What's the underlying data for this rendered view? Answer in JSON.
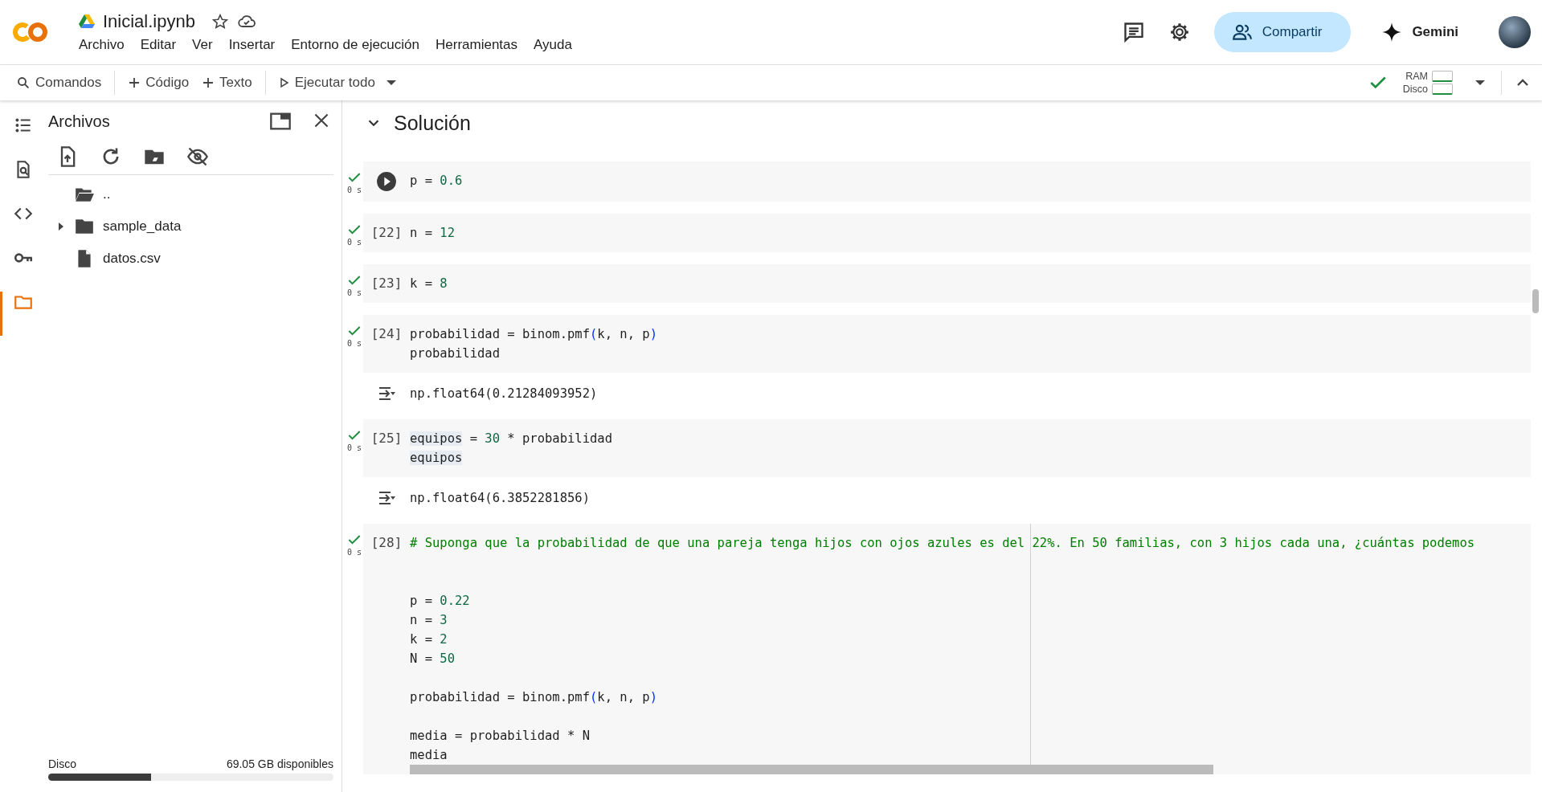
{
  "header": {
    "file_title": "Inicial.ipynb",
    "starred": false,
    "menu": [
      "Archivo",
      "Editar",
      "Ver",
      "Insertar",
      "Entorno de ejecución",
      "Herramientas",
      "Ayuda"
    ],
    "share_button": "Compartir",
    "gemini_button": "Gemini"
  },
  "toolbar": {
    "commands": "Comandos",
    "add_code": "Código",
    "add_text": "Texto",
    "run_all": "Ejecutar todo",
    "ram_label": "RAM",
    "disk_label": "Disco",
    "connected": true
  },
  "rail": [
    {
      "kind": "toc",
      "selected": false
    },
    {
      "kind": "find",
      "selected": false
    },
    {
      "kind": "code",
      "selected": false
    },
    {
      "kind": "key",
      "selected": false
    },
    {
      "kind": "files",
      "selected": true
    }
  ],
  "sidebar": {
    "title": "Archivos",
    "files": [
      {
        "name": "..",
        "kind": "parent"
      },
      {
        "name": "sample_data",
        "kind": "folder",
        "expanded": false
      },
      {
        "name": "datos.csv",
        "kind": "file"
      }
    ],
    "disk": {
      "label": "Disco",
      "available": "69.05 GB disponibles",
      "level": 0.36
    }
  },
  "notebook": {
    "section": {
      "title": "Solución",
      "expanded": true
    },
    "cells": [
      {
        "time": "0 s",
        "lines": [
          {
            "kind": "code",
            "tokens": [
              {
                "kind": "plain",
                "text": "p = "
              },
              {
                "kind": "num",
                "text": "0.6"
              }
            ]
          }
        ]
      },
      {
        "exec_count": "[22]",
        "time": "0 s",
        "lines": [
          {
            "kind": "code",
            "tokens": [
              {
                "kind": "plain",
                "text": "n = "
              },
              {
                "kind": "num",
                "text": "12"
              }
            ]
          }
        ]
      },
      {
        "exec_count": "[23]",
        "time": "0 s",
        "lines": [
          {
            "kind": "code",
            "tokens": [
              {
                "kind": "plain",
                "text": "k = "
              },
              {
                "kind": "num",
                "text": "8"
              }
            ]
          }
        ]
      },
      {
        "exec_count": "[24]",
        "time": "0 s",
        "lines": [
          {
            "kind": "code",
            "tokens": [
              {
                "kind": "plain",
                "text": "probabilidad = binom.pmf"
              },
              {
                "kind": "paren",
                "text": "("
              },
              {
                "kind": "plain",
                "text": "k, n, p"
              },
              {
                "kind": "paren",
                "text": ")"
              }
            ]
          },
          {
            "kind": "code",
            "tokens": [
              {
                "kind": "plain",
                "text": "probabilidad"
              }
            ]
          }
        ],
        "output": "np.float64(0.21284093952)"
      },
      {
        "exec_count": "[25]",
        "time": "0 s",
        "lines": [
          {
            "kind": "code",
            "tokens": [
              {
                "kind": "match",
                "text": "equipos"
              },
              {
                "kind": "plain",
                "text": " = "
              },
              {
                "kind": "num",
                "text": "30"
              },
              {
                "kind": "plain",
                "text": " * probabilidad"
              }
            ]
          },
          {
            "kind": "code",
            "tokens": [
              {
                "kind": "match",
                "text": "equipos"
              }
            ]
          }
        ],
        "output": "np.float64(6.3852281856)"
      },
      {
        "exec_count": "[28]",
        "time": "0 s",
        "lines": [
          {
            "kind": "code",
            "tokens": [
              {
                "kind": "comment",
                "text": "# Suponga que la probabilidad de que una pareja tenga hijos con ojos azules es del 22%. En 50 familias, con 3 hijos cada una, ¿cuántas podemos"
              }
            ]
          },
          {
            "kind": "blank"
          },
          {
            "kind": "blank"
          },
          {
            "kind": "code",
            "tokens": [
              {
                "kind": "plain",
                "text": "p = "
              },
              {
                "kind": "num",
                "text": "0.22"
              }
            ]
          },
          {
            "kind": "code",
            "tokens": [
              {
                "kind": "plain",
                "text": "n = "
              },
              {
                "kind": "num",
                "text": "3"
              }
            ]
          },
          {
            "kind": "code",
            "tokens": [
              {
                "kind": "plain",
                "text": "k = "
              },
              {
                "kind": "num",
                "text": "2"
              }
            ]
          },
          {
            "kind": "code",
            "tokens": [
              {
                "kind": "plain",
                "text": "N = "
              },
              {
                "kind": "num",
                "text": "50"
              }
            ]
          },
          {
            "kind": "blank"
          },
          {
            "kind": "code",
            "tokens": [
              {
                "kind": "plain",
                "text": "probabilidad = binom.pmf"
              },
              {
                "kind": "paren",
                "text": "("
              },
              {
                "kind": "plain",
                "text": "k, n, p"
              },
              {
                "kind": "paren",
                "text": ")"
              }
            ]
          },
          {
            "kind": "blank"
          },
          {
            "kind": "code",
            "tokens": [
              {
                "kind": "plain",
                "text": "media = probabilidad * N"
              }
            ]
          },
          {
            "kind": "code",
            "tokens": [
              {
                "kind": "plain",
                "text": "media"
              }
            ]
          }
        ]
      }
    ]
  }
}
